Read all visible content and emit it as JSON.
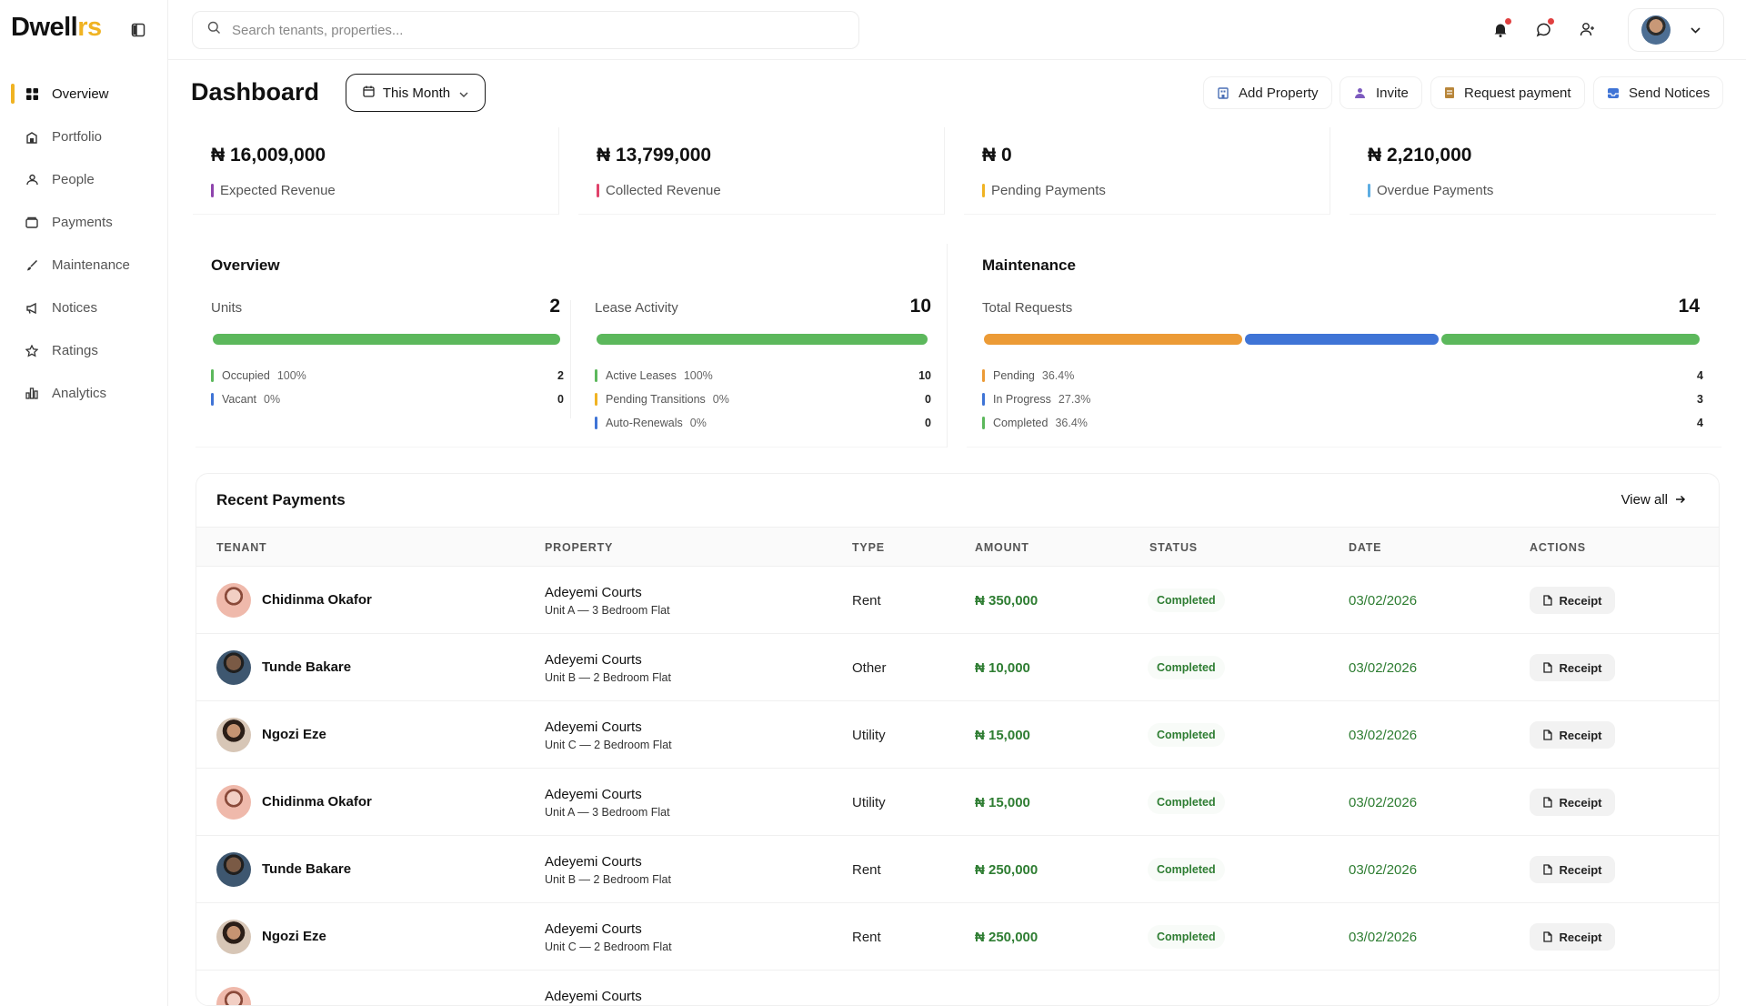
{
  "brand": {
    "name_main": "Dwell",
    "name_accent": "rs"
  },
  "sidebar": {
    "items": [
      {
        "label": "Overview",
        "icon": "grid-icon",
        "active": true
      },
      {
        "label": "Portfolio",
        "icon": "building-icon"
      },
      {
        "label": "People",
        "icon": "people-icon"
      },
      {
        "label": "Payments",
        "icon": "wallet-icon"
      },
      {
        "label": "Maintenance",
        "icon": "brush-icon"
      },
      {
        "label": "Notices",
        "icon": "megaphone-icon"
      },
      {
        "label": "Ratings",
        "icon": "star-icon"
      },
      {
        "label": "Analytics",
        "icon": "bar-chart-icon"
      }
    ]
  },
  "search": {
    "placeholder": "Search tenants, properties..."
  },
  "header": {
    "title": "Dashboard",
    "period": "This Month",
    "actions": {
      "add_property": "Add Property",
      "invite": "Invite",
      "request_payment": "Request payment",
      "send_notices": "Send Notices"
    }
  },
  "stats": [
    {
      "value": "₦ 16,009,000",
      "label": "Expected Revenue",
      "color": "#8e44ad"
    },
    {
      "value": "₦ 13,799,000",
      "label": "Collected Revenue",
      "color": "#e0436b"
    },
    {
      "value": "₦ 0",
      "label": "Pending Payments",
      "color": "#f0b323"
    },
    {
      "value": "₦ 2,210,000",
      "label": "Overdue Payments",
      "color": "#5dade2"
    }
  ],
  "overview": {
    "title": "Overview",
    "units": {
      "label": "Units",
      "total": "2",
      "rows": [
        {
          "label": "Occupied",
          "pct": "100%",
          "count": "2",
          "color": "#5cb85c"
        },
        {
          "label": "Vacant",
          "pct": "0%",
          "count": "0",
          "color": "#3f74d6"
        }
      ]
    },
    "lease": {
      "label": "Lease Activity",
      "total": "10",
      "rows": [
        {
          "label": "Active Leases",
          "pct": "100%",
          "count": "10",
          "color": "#5cb85c"
        },
        {
          "label": "Pending Transitions",
          "pct": "0%",
          "count": "0",
          "color": "#f0b323"
        },
        {
          "label": "Auto-Renewals",
          "pct": "0%",
          "count": "0",
          "color": "#3f74d6"
        }
      ]
    }
  },
  "maintenance": {
    "title": "Maintenance",
    "label": "Total Requests",
    "total": "14",
    "rows": [
      {
        "label": "Pending",
        "pct": "36.4%",
        "count": "4",
        "color": "#ec9b36",
        "fraction": 0.364
      },
      {
        "label": "In Progress",
        "pct": "27.3%",
        "count": "3",
        "color": "#3f74d6",
        "fraction": 0.273
      },
      {
        "label": "Completed",
        "pct": "36.4%",
        "count": "4",
        "color": "#5cb85c",
        "fraction": 0.364
      }
    ]
  },
  "payments": {
    "title": "Recent Payments",
    "view_all": "View all",
    "columns": [
      "TENANT",
      "PROPERTY",
      "TYPE",
      "AMOUNT",
      "STATUS",
      "DATE",
      "ACTIONS"
    ],
    "receipt_label": "Receipt",
    "rows": [
      {
        "tenant": "Chidinma Okafor",
        "avatar": "pink",
        "property": "Adeyemi Courts",
        "unit": "Unit A — 3 Bedroom Flat",
        "type": "Rent",
        "amount": "₦ 350,000",
        "status": "Completed",
        "date": "03/02/2026"
      },
      {
        "tenant": "Tunde Bakare",
        "avatar": "dark",
        "property": "Adeyemi Courts",
        "unit": "Unit B — 2 Bedroom Flat",
        "type": "Other",
        "amount": "₦ 10,000",
        "status": "Completed",
        "date": "03/02/2026"
      },
      {
        "tenant": "Ngozi Eze",
        "avatar": "brown",
        "property": "Adeyemi Courts",
        "unit": "Unit C — 2 Bedroom Flat",
        "type": "Utility",
        "amount": "₦ 15,000",
        "status": "Completed",
        "date": "03/02/2026"
      },
      {
        "tenant": "Chidinma Okafor",
        "avatar": "pink",
        "property": "Adeyemi Courts",
        "unit": "Unit A — 3 Bedroom Flat",
        "type": "Utility",
        "amount": "₦ 15,000",
        "status": "Completed",
        "date": "03/02/2026"
      },
      {
        "tenant": "Tunde Bakare",
        "avatar": "dark",
        "property": "Adeyemi Courts",
        "unit": "Unit B — 2 Bedroom Flat",
        "type": "Rent",
        "amount": "₦ 250,000",
        "status": "Completed",
        "date": "03/02/2026"
      },
      {
        "tenant": "Ngozi Eze",
        "avatar": "brown",
        "property": "Adeyemi Courts",
        "unit": "Unit C — 2 Bedroom Flat",
        "type": "Rent",
        "amount": "₦ 250,000",
        "status": "Completed",
        "date": "03/02/2026"
      },
      {
        "tenant": "",
        "avatar": "pink",
        "property": "Adeyemi Courts",
        "unit": "",
        "type": "",
        "amount": "",
        "status": "",
        "date": ""
      }
    ]
  }
}
